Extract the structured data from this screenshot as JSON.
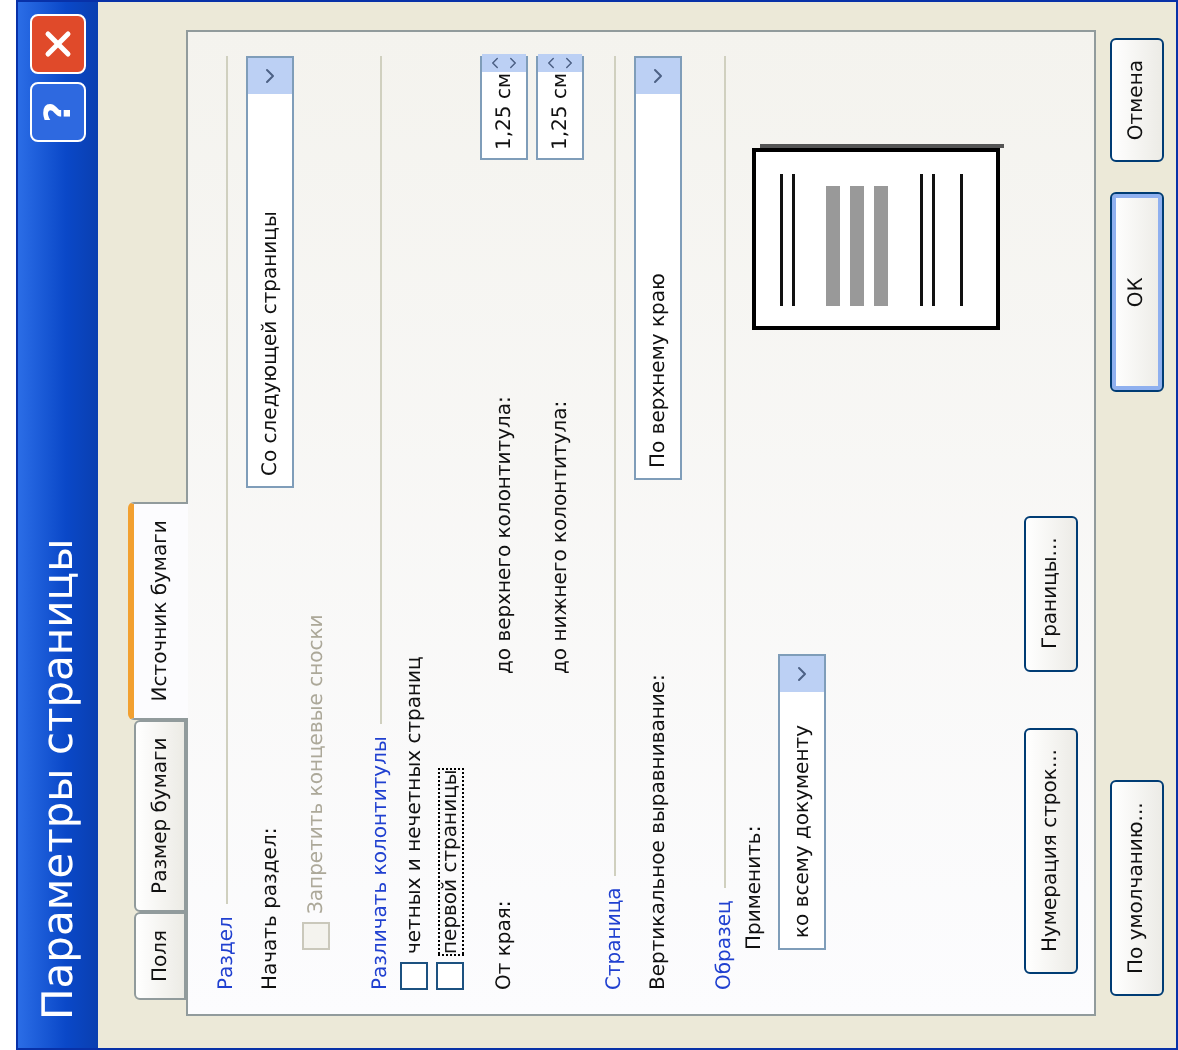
{
  "window": {
    "title": "Параметры страницы",
    "help_label": "?"
  },
  "tabs": [
    {
      "label": "Поля",
      "selected": false
    },
    {
      "label": "Размер бумаги",
      "selected": false
    },
    {
      "label": "Источник бумаги",
      "selected": true
    }
  ],
  "section": {
    "title": "Раздел",
    "start_label": "Начать раздел:",
    "start_value": "Со следующей страницы",
    "endnotes": {
      "label": "Запретить концевые сноски",
      "checked": false,
      "disabled": true
    }
  },
  "headers_footers": {
    "title": "Различать колонтитулы",
    "options": [
      {
        "label": "четных и нечетных страниц",
        "checked": false,
        "focused": false
      },
      {
        "label": "первой страницы",
        "checked": false,
        "focused": true
      }
    ],
    "from_edge_label": "От края:",
    "distances": [
      {
        "label": "до верхнего колонтитула:",
        "value": "1,25 см"
      },
      {
        "label": "до нижнего колонтитула:",
        "value": "1,25 см"
      }
    ]
  },
  "page": {
    "title": "Страница",
    "valign_label": "Вертикальное выравнивание:",
    "valign_value": "По верхнему краю"
  },
  "preview": {
    "title": "Образец",
    "apply_label": "Применить:",
    "apply_value": "ко всему документу"
  },
  "panel_buttons": [
    "Нумерация строк...",
    "Границы..."
  ],
  "footer_buttons": [
    {
      "label": "По умолчанию...",
      "kind": "secondary"
    },
    {
      "label": "ОК",
      "kind": "default"
    },
    {
      "label": "Отмена",
      "kind": "secondary"
    }
  ]
}
